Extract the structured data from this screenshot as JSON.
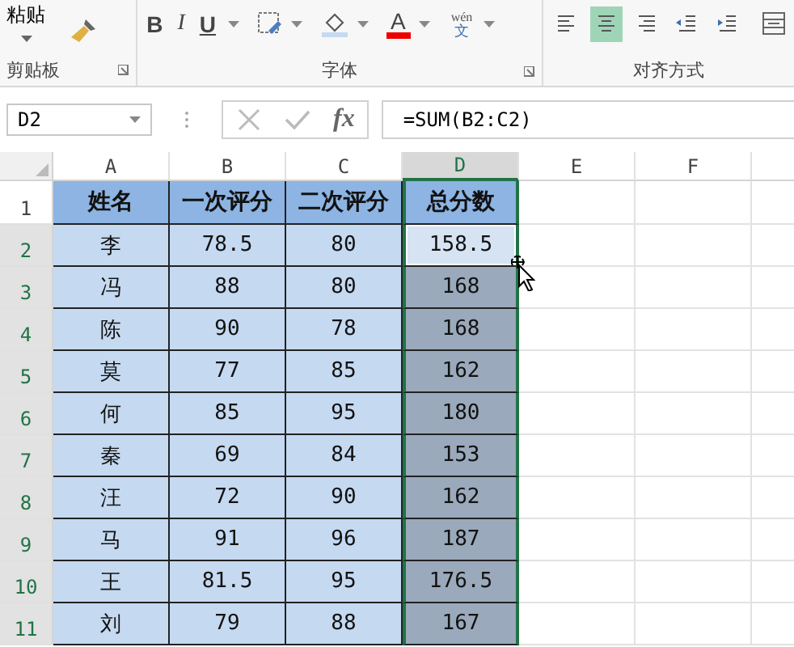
{
  "ribbon": {
    "clipboard": {
      "paste_label": "粘贴",
      "group_label": "剪贴板"
    },
    "font": {
      "bold": "B",
      "italic": "I",
      "underline": "U",
      "font_color": "A",
      "phonetic_top": "wén",
      "phonetic_bottom": "文",
      "group_label": "字体"
    },
    "alignment": {
      "buttons": [
        {
          "kind": "left",
          "selected": false
        },
        {
          "kind": "center",
          "selected": true
        },
        {
          "kind": "right",
          "selected": false
        },
        {
          "kind": "outdent",
          "selected": false
        },
        {
          "kind": "indent",
          "selected": false
        }
      ],
      "group_label": "对齐方式"
    }
  },
  "formula_bar": {
    "name_box": "D2",
    "fx": "fx",
    "formula": "=SUM(B2:C2)"
  },
  "columns": [
    {
      "label": "A",
      "selected": false
    },
    {
      "label": "B",
      "selected": false
    },
    {
      "label": "C",
      "selected": false
    },
    {
      "label": "D",
      "selected": true
    },
    {
      "label": "E",
      "selected": false
    },
    {
      "label": "F",
      "selected": false
    }
  ],
  "rows": [
    {
      "number": "1",
      "header": true,
      "selected": false,
      "active": false,
      "cells": [
        "姓名",
        "一次评分",
        "二次评分",
        "总分数"
      ]
    },
    {
      "number": "2",
      "header": false,
      "selected": true,
      "active": true,
      "cells": [
        "李",
        "78.5",
        "80",
        "158.5"
      ]
    },
    {
      "number": "3",
      "header": false,
      "selected": true,
      "active": false,
      "cells": [
        "冯",
        "88",
        "80",
        "168"
      ]
    },
    {
      "number": "4",
      "header": false,
      "selected": true,
      "active": false,
      "cells": [
        "陈",
        "90",
        "78",
        "168"
      ]
    },
    {
      "number": "5",
      "header": false,
      "selected": true,
      "active": false,
      "cells": [
        "莫",
        "77",
        "85",
        "162"
      ]
    },
    {
      "number": "6",
      "header": false,
      "selected": true,
      "active": false,
      "cells": [
        "何",
        "85",
        "95",
        "180"
      ]
    },
    {
      "number": "7",
      "header": false,
      "selected": true,
      "active": false,
      "cells": [
        "秦",
        "69",
        "84",
        "153"
      ]
    },
    {
      "number": "8",
      "header": false,
      "selected": true,
      "active": false,
      "cells": [
        "汪",
        "72",
        "90",
        "162"
      ]
    },
    {
      "number": "9",
      "header": false,
      "selected": true,
      "active": false,
      "cells": [
        "马",
        "91",
        "96",
        "187"
      ]
    },
    {
      "number": "10",
      "header": false,
      "selected": true,
      "active": false,
      "cells": [
        "王",
        "81.5",
        "95",
        "176.5"
      ]
    },
    {
      "number": "11",
      "header": false,
      "selected": true,
      "active": false,
      "cells": [
        "刘",
        "79",
        "88",
        "167"
      ]
    }
  ]
}
